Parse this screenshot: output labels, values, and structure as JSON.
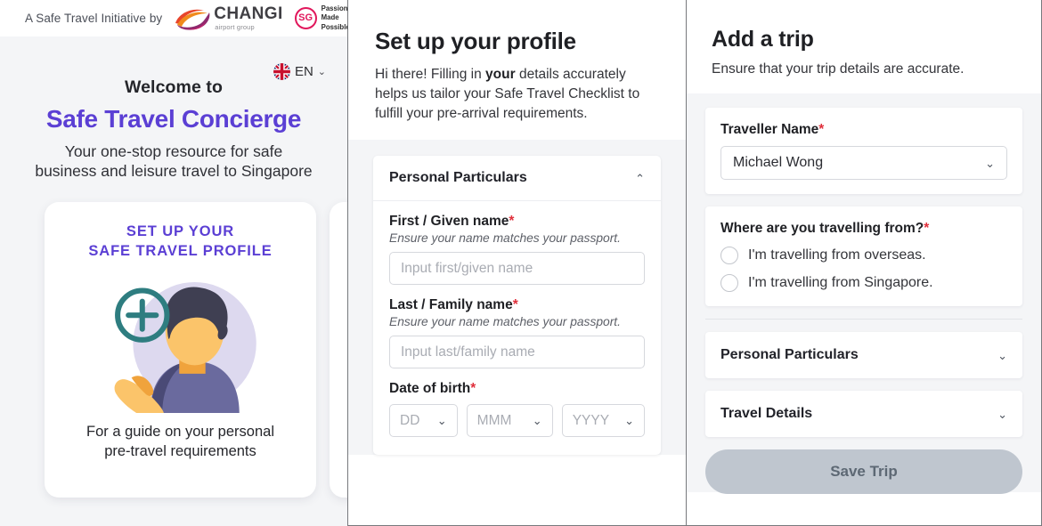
{
  "colors": {
    "brand_purple": "#5b3fd4",
    "required_red": "#e0303c",
    "sg_red": "#e1175c",
    "panel_bg": "#f4f5f7",
    "save_btn": "#bfc6cf"
  },
  "panel1": {
    "brandbar": {
      "text": "A Safe Travel Initiative by",
      "changi_name": "CHANGI",
      "changi_sub": "airport group",
      "sg_mark": "SG",
      "sg_tagline": "Passion\nMade\nPossible",
      "sg_tagline_lines": [
        "Passion",
        "Made",
        "Possible"
      ]
    },
    "language": {
      "label": "EN",
      "chevron": "⌄"
    },
    "hero": {
      "welcome": "Welcome to",
      "title": "Safe Travel Concierge",
      "subtitle_line1": "Your one-stop resource for safe",
      "subtitle_line2": "business and leisure travel to Singapore"
    },
    "card": {
      "title_line1": "SET UP YOUR",
      "title_line2": "SAFE TRAVEL PROFILE",
      "caption_line1": "For a guide on your personal",
      "caption_line2": "pre-travel requirements"
    }
  },
  "panel2": {
    "title": "Set up your profile",
    "desc_part1": "Hi there! Filling in ",
    "desc_bold": "your",
    "desc_part2": " details accurately helps us tailor your Safe Travel Checklist to fulfill your pre-arrival requirements.",
    "accordion": {
      "title": "Personal Particulars",
      "chevron": "⌃"
    },
    "fields": [
      {
        "label": "First / Given name",
        "required": "*",
        "hint": "Ensure your name matches your passport.",
        "placeholder": "Input first/given name",
        "value": ""
      },
      {
        "label": "Last / Family name",
        "required": "*",
        "hint": "Ensure your name matches your passport.",
        "placeholder": "Input last/family name",
        "value": ""
      }
    ],
    "dob": {
      "label": "Date of birth",
      "required": "*",
      "day": "DD",
      "month": "MMM",
      "year": "YYYY",
      "chevron": "⌄"
    }
  },
  "panel3": {
    "title": "Add a trip",
    "desc": "Ensure that your trip details are accurate.",
    "traveller": {
      "label": "Traveller Name",
      "required": "*",
      "value": "Michael Wong",
      "chevron": "⌄"
    },
    "origin": {
      "label": "Where are you travelling from?",
      "required": "*",
      "options": [
        {
          "label": "I'm travelling from overseas.",
          "selected": false
        },
        {
          "label": "I'm travelling from Singapore.",
          "selected": false
        }
      ]
    },
    "sections": [
      {
        "title": "Personal Particulars",
        "chevron": "⌄"
      },
      {
        "title": "Travel Details",
        "chevron": "⌄"
      }
    ],
    "save_label": "Save Trip"
  }
}
